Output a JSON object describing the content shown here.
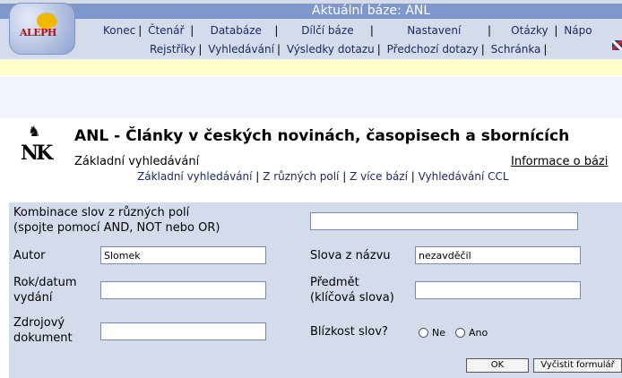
{
  "header": {
    "title": "Aktuální báze:  ANL",
    "logo_text": "ALEPH",
    "menu_top": [
      "Konec",
      "Čtenář",
      "Databáze",
      "Dílčí báze",
      "Nastavení",
      "Otázky",
      "Nápo"
    ],
    "menu_bottom": [
      "Rejstříky",
      "Vyhledávání",
      "Výsledky dotazu",
      "Předchozí dotazy",
      "Schránka"
    ]
  },
  "search_types": [
    "Základní vyhledávání",
    "Z různých polí",
    "Z více bází",
    "Vyhledávání CCL"
  ],
  "base": {
    "logo_text": "NK",
    "title": "ANL - Články v českých novinách, časopisech a sbornících",
    "subtitle": "Základní vyhledávání",
    "info_link": "Informace o bázi"
  },
  "form": {
    "combo_label_1": "Kombinace slov z různých polí",
    "combo_label_2": "(spojte pomocí AND, NOT nebo OR)",
    "combo_value": "",
    "author_label": "Autor",
    "author_value": "Slomek",
    "title_words_label": "Slova z názvu",
    "title_words_value": "nezavděčil",
    "year_label_1": "Rok/datum",
    "year_label_2": "vydání",
    "year_value": "",
    "subject_label_1": "Předmět",
    "subject_label_2": "(klíčová slova)",
    "subject_value": "",
    "source_label_1": "Zdrojový",
    "source_label_2": "dokument",
    "source_value": "",
    "proximity_label": "Blízkost slov?",
    "proximity_no": "Ne",
    "proximity_yes": "Ano",
    "ok_button": "OK",
    "clear_button": "Vyčistit formulář"
  }
}
